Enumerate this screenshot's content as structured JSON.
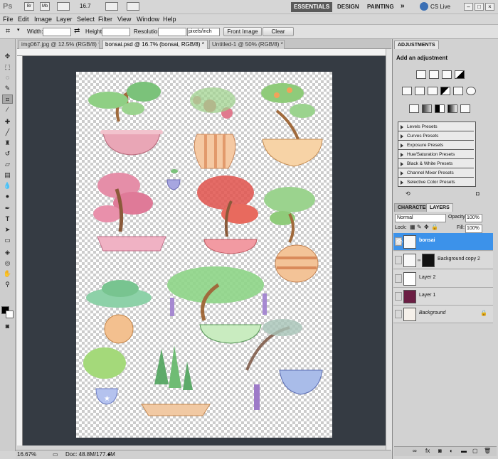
{
  "app": {
    "logo": "Ps",
    "zoom_field": "16.7",
    "workspaces": [
      "ESSENTIALS",
      "DESIGN",
      "PAINTING"
    ],
    "more": "»",
    "cslive": "CS Live",
    "colors": {
      "active_ws": "#5a5a5a",
      "layer_selected": "#3c92ea",
      "canvas_bg": "#353b43"
    }
  },
  "menu": [
    "File",
    "Edit",
    "Image",
    "Layer",
    "Select",
    "Filter",
    "View",
    "Window",
    "Help"
  ],
  "options": {
    "width_label": "Width:",
    "width_value": "",
    "height_label": "Height:",
    "height_value": "",
    "resolution_label": "Resolution:",
    "resolution_value": "",
    "unit": "pixels/inch",
    "front_image": "Front Image",
    "clear": "Clear"
  },
  "tabs": [
    {
      "label": "img067.jpg @ 12.5% (RGB/8) *"
    },
    {
      "label": "bonsai.psd @ 16.7% (bonsai, RGB/8) *"
    },
    {
      "label": "Untitled-1 @ 50% (RGB/8) *"
    }
  ],
  "status": {
    "zoom": "16.67%",
    "doc": "Doc: 48.8M/177.4M"
  },
  "adjustments": {
    "tab": "ADJUSTMENTS",
    "header": "Add an adjustment",
    "presets": [
      "Levels Presets",
      "Curves Presets",
      "Exposure Presets",
      "Hue/Saturation Presets",
      "Black & White Presets",
      "Channel Mixer Presets",
      "Selective Color Presets"
    ]
  },
  "layers_panel": {
    "tabs": [
      "CHARACTER",
      "LAYERS"
    ],
    "blend_mode": "Normal",
    "opacity_label": "Opacity:",
    "opacity": "100%",
    "lock_label": "Lock:",
    "fill_label": "Fill:",
    "fill": "100%",
    "layers": [
      {
        "name": "bonsai",
        "selected": true,
        "visible": true
      },
      {
        "name": "Background copy 2",
        "selected": false,
        "visible": false
      },
      {
        "name": "Layer 2",
        "selected": false,
        "visible": false
      },
      {
        "name": "Layer 1",
        "selected": false,
        "visible": false
      },
      {
        "name": "Background",
        "selected": false,
        "visible": false,
        "locked": true
      }
    ]
  }
}
